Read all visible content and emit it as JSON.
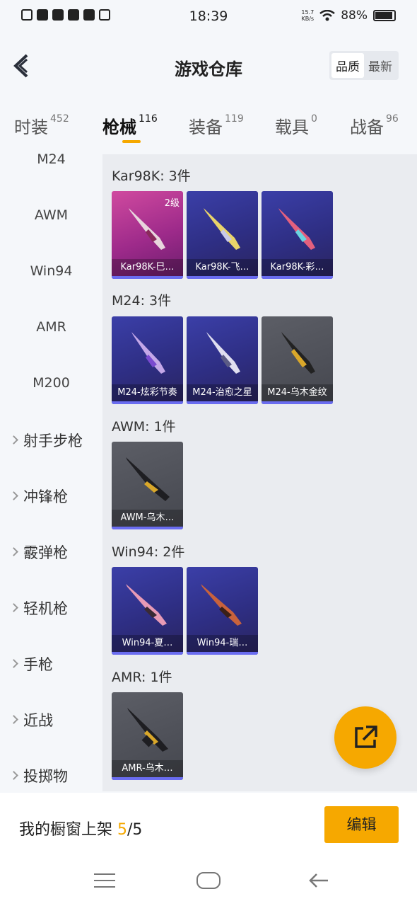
{
  "status_bar": {
    "time": "18:39",
    "speed_top": "15.7",
    "speed_bottom": "KB/s",
    "battery": "88%"
  },
  "header": {
    "title": "游戏仓库",
    "sort_options": [
      "品质",
      "最新"
    ]
  },
  "tabs": [
    {
      "label": "时装",
      "count": "452"
    },
    {
      "label": "枪械",
      "count": "116"
    },
    {
      "label": "装备",
      "count": "119"
    },
    {
      "label": "载具",
      "count": "0"
    },
    {
      "label": "战备",
      "count": "96"
    }
  ],
  "sidebar": {
    "items": [
      "M24",
      "AWM",
      "Win94",
      "AMR",
      "M200"
    ],
    "groups": [
      "射手步枪",
      "冲锋枪",
      "霰弹枪",
      "轻机枪",
      "手枪",
      "近战",
      "投掷物"
    ]
  },
  "sections": [
    {
      "title": "Kar98K: 3件",
      "cards": [
        {
          "label": "Kar98K-巳…",
          "level": "2级",
          "rarity": "pink"
        },
        {
          "label": "Kar98K-飞…",
          "rarity": "purple"
        },
        {
          "label": "Kar98K-彩…",
          "rarity": "purple"
        }
      ]
    },
    {
      "title": "M24: 3件",
      "cards": [
        {
          "label": "M24-炫彩节奏",
          "rarity": "purple"
        },
        {
          "label": "M24-治愈之星",
          "rarity": "purple"
        },
        {
          "label": "M24-乌木金纹",
          "rarity": "gray"
        }
      ]
    },
    {
      "title": "AWM: 1件",
      "cards": [
        {
          "label": "AWM-乌木…",
          "rarity": "gray"
        }
      ]
    },
    {
      "title": "Win94: 2件",
      "cards": [
        {
          "label": "Win94-夏…",
          "rarity": "purple"
        },
        {
          "label": "Win94-瑞…",
          "rarity": "purple"
        }
      ]
    },
    {
      "title": "AMR: 1件",
      "cards": [
        {
          "label": "AMR-乌木…",
          "rarity": "gray"
        }
      ]
    }
  ],
  "bottom_bar": {
    "shelf_label": "我的橱窗上架",
    "shelf_current": "5",
    "shelf_total": "/5",
    "edit_label": "编辑"
  },
  "colors": {
    "accent": "#f6a800",
    "pink_card": "#c2439c",
    "purple_card": "#2f2f86",
    "gray_card": "#54565e",
    "stripe": "#6a6cf0"
  }
}
